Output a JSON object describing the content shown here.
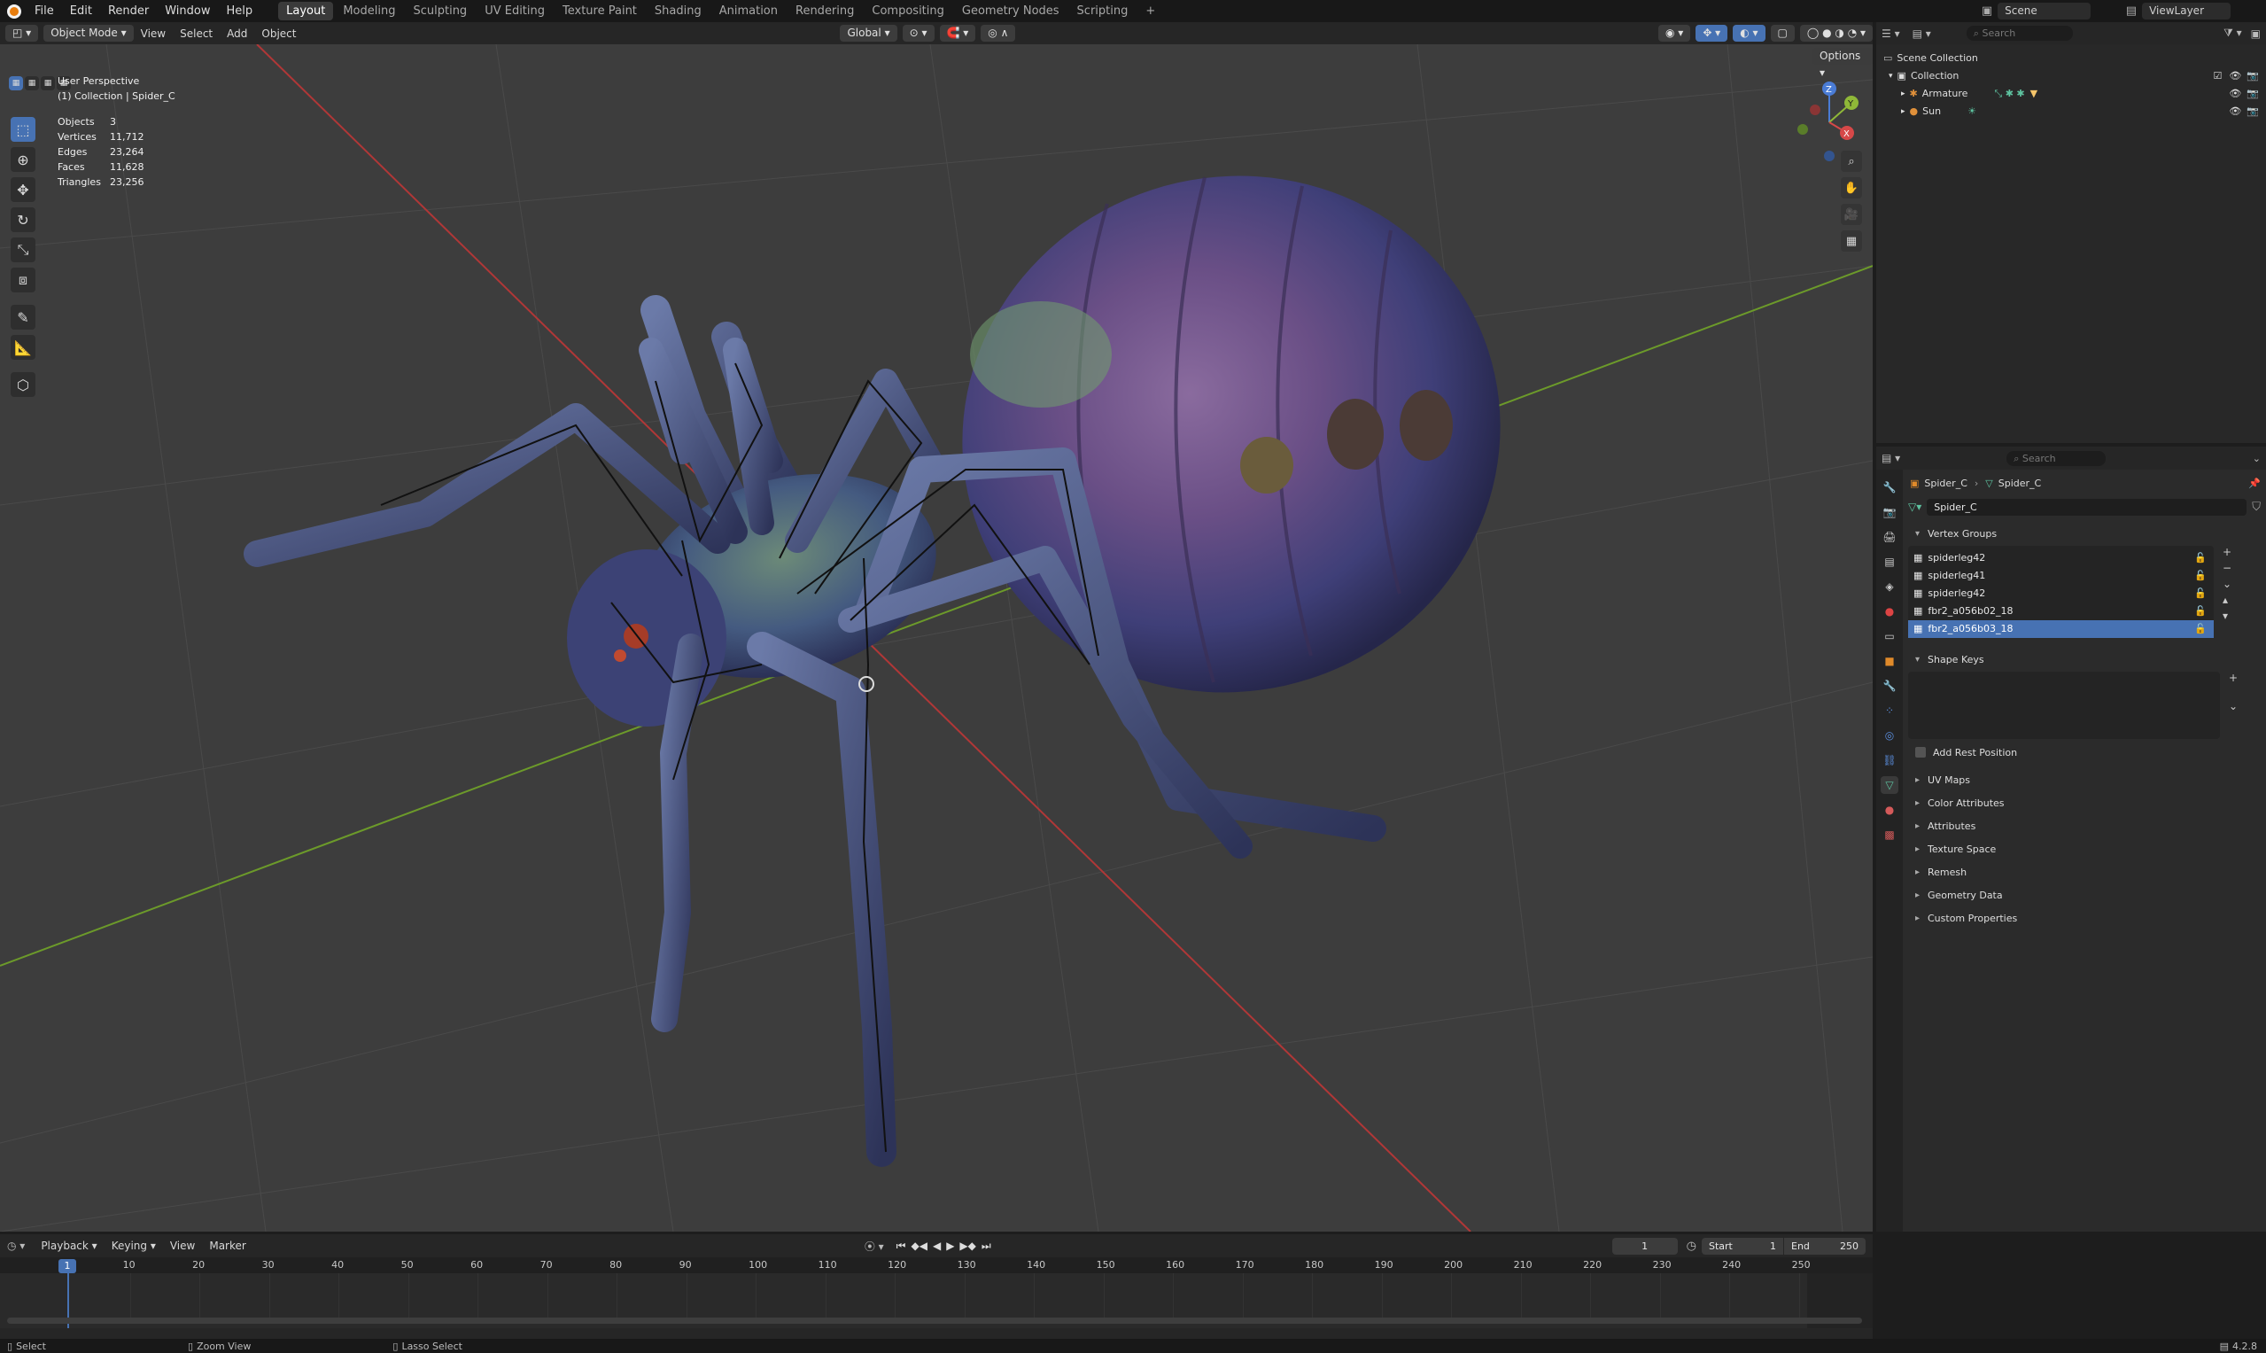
{
  "topbar": {
    "menus": [
      "File",
      "Edit",
      "Render",
      "Window",
      "Help"
    ],
    "workspaces": [
      "Layout",
      "Modeling",
      "Sculpting",
      "UV Editing",
      "Texture Paint",
      "Shading",
      "Animation",
      "Rendering",
      "Compositing",
      "Geometry Nodes",
      "Scripting"
    ],
    "active_workspace": "Layout",
    "scene_name": "Scene",
    "view_layer": "ViewLayer"
  },
  "viewport_header": {
    "mode": "Object Mode",
    "menus": [
      "View",
      "Select",
      "Add",
      "Object"
    ],
    "orientation": "Global",
    "options_label": "Options"
  },
  "overlay": {
    "view_name": "User Perspective",
    "collection_label": "(1) Collection | Spider_C",
    "stats": [
      {
        "k": "Objects",
        "v": "3"
      },
      {
        "k": "Vertices",
        "v": "11,712"
      },
      {
        "k": "Edges",
        "v": "23,264"
      },
      {
        "k": "Faces",
        "v": "11,628"
      },
      {
        "k": "Triangles",
        "v": "23,256"
      }
    ]
  },
  "gizmo": {
    "x": "X",
    "y": "Y",
    "z": "Z"
  },
  "outliner": {
    "search_placeholder": "Search",
    "scene_collection": "Scene Collection",
    "collection": "Collection",
    "items": [
      "Armature",
      "Sun"
    ]
  },
  "properties": {
    "search_placeholder": "Search",
    "breadcrumb_object": "Spider_C",
    "breadcrumb_data": "Spider_C",
    "mesh_name": "Spider_C",
    "vertex_groups_label": "Vertex Groups",
    "vertex_groups": [
      "spiderleg42",
      "spiderleg41",
      "spiderleg42",
      "fbr2_a056b02_18",
      "fbr2_a056b03_18"
    ],
    "selected_vertex_group": 4,
    "shape_keys_label": "Shape Keys",
    "add_rest_position": "Add Rest Position",
    "panels": [
      "UV Maps",
      "Color Attributes",
      "Attributes",
      "Texture Space",
      "Remesh",
      "Geometry Data",
      "Custom Properties"
    ]
  },
  "timeline": {
    "menus": [
      "Playback",
      "Keying",
      "View",
      "Marker"
    ],
    "current_frame": "1",
    "start_label": "Start",
    "start": "1",
    "end_label": "End",
    "end": "250",
    "ticks": [
      "1",
      "10",
      "20",
      "30",
      "40",
      "50",
      "60",
      "70",
      "80",
      "90",
      "100",
      "110",
      "120",
      "130",
      "140",
      "150",
      "160",
      "170",
      "180",
      "190",
      "200",
      "210",
      "220",
      "230",
      "240",
      "250"
    ]
  },
  "statusbar": {
    "hints": [
      "Select",
      "Zoom View",
      "Lasso Select"
    ],
    "version": "4.2.8"
  },
  "colors": {
    "accent": "#4772b3",
    "x_axis": "#c23c3c",
    "y_axis": "#7aa52f"
  }
}
